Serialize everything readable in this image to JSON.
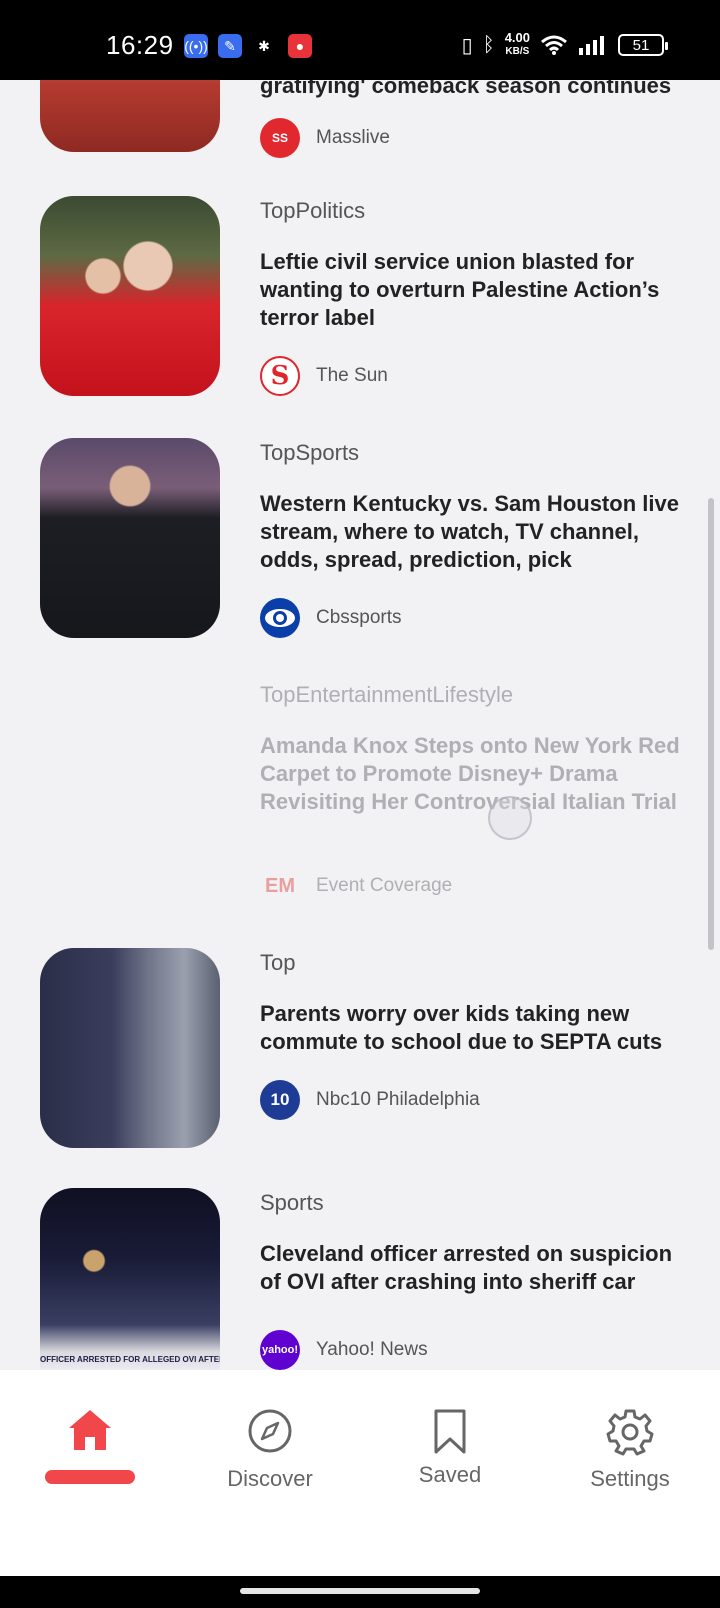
{
  "status_bar": {
    "time": "16:29",
    "network_speed_value": "4.00",
    "network_speed_unit": "KB/S",
    "battery": "51"
  },
  "articles": [
    {
      "category": "",
      "headline": "gratifying' comeback season continues",
      "source": "Masslive",
      "source_logo_text": "SS",
      "source_color": "#e0282e",
      "icon": "baseball-photo"
    },
    {
      "category": "TopPolitics",
      "headline": "Leftie civil service union blasted for wanting to overturn Palestine Action’s terror label",
      "source": "The Sun",
      "source_logo_text": "S",
      "source_color": "#e2252c",
      "icon": "protest-photo"
    },
    {
      "category": "TopSports",
      "headline": "Western Kentucky vs. Sam Houston live stream, where to watch, TV channel, odds, spread, prediction, pick",
      "source": "Cbssports",
      "source_logo_text": "",
      "source_color": "#0a3ea8",
      "icon": "coach-photo"
    },
    {
      "category": "TopEntertainmentLifestyle",
      "headline": "Amanda Knox Steps onto New York Red Carpet to Promote Disney+ Drama Revisiting Her Controversial Italian Trial",
      "source": "Event Coverage",
      "source_logo_text": "EM",
      "source_color": "#e25a5a",
      "icon": "none"
    },
    {
      "category": "Top",
      "headline": "Parents worry over kids taking new commute to school due to SEPTA cuts",
      "source": "Nbc10 Philadelphia",
      "source_logo_text": "10",
      "source_color": "#1e3c96",
      "icon": "train-platform-photo"
    },
    {
      "category": "Sports",
      "headline": "Cleveland officer arrested on suspicion of OVI after crashing into sheriff car",
      "source": "Yahoo! News",
      "source_logo_text": "yahoo!",
      "source_color": "#5f01d1",
      "icon": "police-scene-photo",
      "thumb_caption": "OFFICER ARRESTED FOR ALLEGED OVI AFTER"
    }
  ],
  "bottom_nav": {
    "accent_color": "#f1474a",
    "items": [
      {
        "label": "",
        "icon": "home-icon",
        "active": true
      },
      {
        "label": "Discover",
        "icon": "compass-icon",
        "active": false
      },
      {
        "label": "Saved",
        "icon": "bookmark-icon",
        "active": false
      },
      {
        "label": "Settings",
        "icon": "gear-icon",
        "active": false
      }
    ]
  }
}
